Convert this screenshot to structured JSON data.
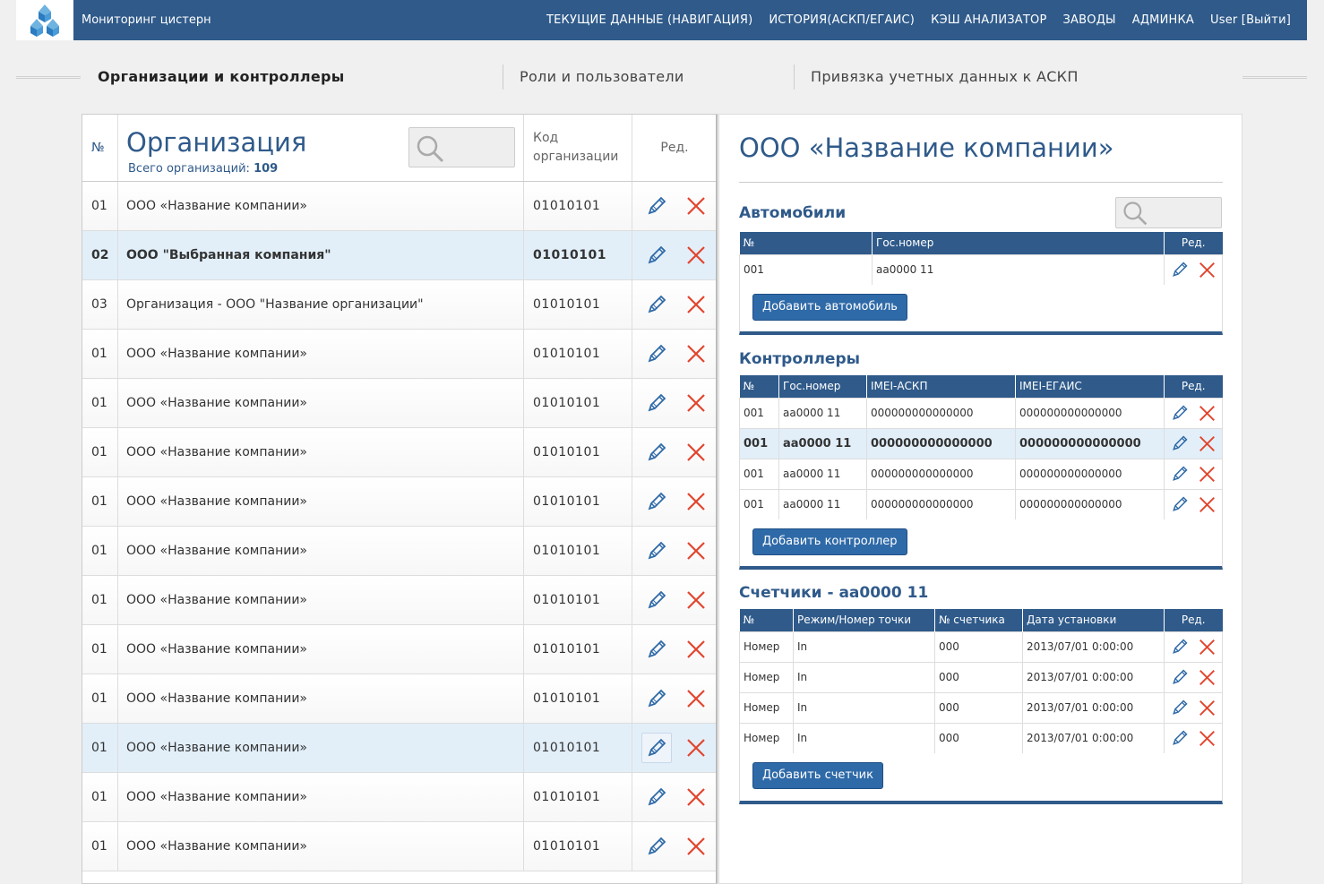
{
  "header": {
    "app_title": "Мониторинг цистерн",
    "nav": [
      "ТЕКУЩИЕ ДАННЫЕ (НАВИГАЦИЯ)",
      "ИСТОРИЯ(АСКП/ЕГАИС)",
      "КЭШ АНАЛИЗАТОР",
      "ЗАВОДЫ",
      "АДМИНКА",
      "User [Выйти]"
    ]
  },
  "tabs": [
    {
      "label": "Организации и контроллеры",
      "active": true
    },
    {
      "label": "Роли и пользователи",
      "active": false
    },
    {
      "label": "Привязка учетных данных к АСКП",
      "active": false
    }
  ],
  "orgs": {
    "col_num": "№",
    "title": "Организация",
    "count_label": "Всего организаций:",
    "count": "109",
    "col_code_line1": "Код",
    "col_code_line2": "организации",
    "col_edit": "Ред.",
    "rows": [
      {
        "num": "01",
        "name": "ООО «Название компании»",
        "code": "01010101"
      },
      {
        "num": "02",
        "name": "ООО \"Выбранная компания\"",
        "code": "01010101"
      },
      {
        "num": "03",
        "name": "Организация - ООО \"Название организации\"",
        "code": "01010101"
      },
      {
        "num": "01",
        "name": "ООО «Название компании»",
        "code": "01010101"
      },
      {
        "num": "01",
        "name": "ООО «Название компании»",
        "code": "01010101"
      },
      {
        "num": "01",
        "name": "ООО «Название компании»",
        "code": "01010101"
      },
      {
        "num": "01",
        "name": "ООО «Название компании»",
        "code": "01010101"
      },
      {
        "num": "01",
        "name": "ООО «Название компании»",
        "code": "01010101"
      },
      {
        "num": "01",
        "name": "ООО «Название компании»",
        "code": "01010101"
      },
      {
        "num": "01",
        "name": "ООО «Название компании»",
        "code": "01010101"
      },
      {
        "num": "01",
        "name": "ООО «Название компании»",
        "code": "01010101"
      },
      {
        "num": "01",
        "name": "ООО «Название компании»",
        "code": "01010101"
      },
      {
        "num": "01",
        "name": "ООО «Название компании»",
        "code": "01010101"
      },
      {
        "num": "01",
        "name": "ООО «Название компании»",
        "code": "01010101"
      }
    ]
  },
  "detail": {
    "company_title": "ООО «Название компании»",
    "cars": {
      "title": "Автомобили",
      "cols": [
        "№",
        "Гос.номер",
        "Ред."
      ],
      "rows": [
        {
          "num": "001",
          "plate": "aa0000 11"
        }
      ],
      "add_button": "Добавить автомобиль"
    },
    "controllers": {
      "title": "Контроллеры",
      "cols": [
        "№",
        "Гос.номер",
        "IMEI-АСКП",
        "IMEI-ЕГАИС",
        "Ред."
      ],
      "rows": [
        {
          "num": "001",
          "plate": "aa0000 11",
          "imei_askp": "000000000000000",
          "imei_egais": "000000000000000"
        },
        {
          "num": "001",
          "plate": "aa0000 11",
          "imei_askp": "000000000000000",
          "imei_egais": "000000000000000"
        },
        {
          "num": "001",
          "plate": "aa0000 11",
          "imei_askp": "000000000000000",
          "imei_egais": "000000000000000"
        },
        {
          "num": "001",
          "plate": "aa0000 11",
          "imei_askp": "000000000000000",
          "imei_egais": "000000000000000"
        }
      ],
      "add_button": "Добавить контроллер"
    },
    "meters": {
      "title": "Счетчики - aa0000 11",
      "cols": [
        "№",
        "Режим/Номер точки",
        "№ счетчика",
        "Дата установки",
        "Ред."
      ],
      "rows": [
        {
          "num": "Номер",
          "mode": "In",
          "meter": "000",
          "date": "2013/07/01 0:00:00"
        },
        {
          "num": "Номер",
          "mode": "In",
          "meter": "000",
          "date": "2013/07/01 0:00:00"
        },
        {
          "num": "Номер",
          "mode": "In",
          "meter": "000",
          "date": "2013/07/01 0:00:00"
        },
        {
          "num": "Номер",
          "mode": "In",
          "meter": "000",
          "date": "2013/07/01 0:00:00"
        }
      ],
      "add_button": "Добавить счетчик"
    }
  },
  "colors": {
    "primary": "#2f5a8a",
    "selected_row": "#e2eff9",
    "delete": "#e2452e",
    "button": "#2f6aa8"
  },
  "icons": [
    "logo-icon",
    "search-icon",
    "pencil-icon",
    "delete-icon"
  ]
}
